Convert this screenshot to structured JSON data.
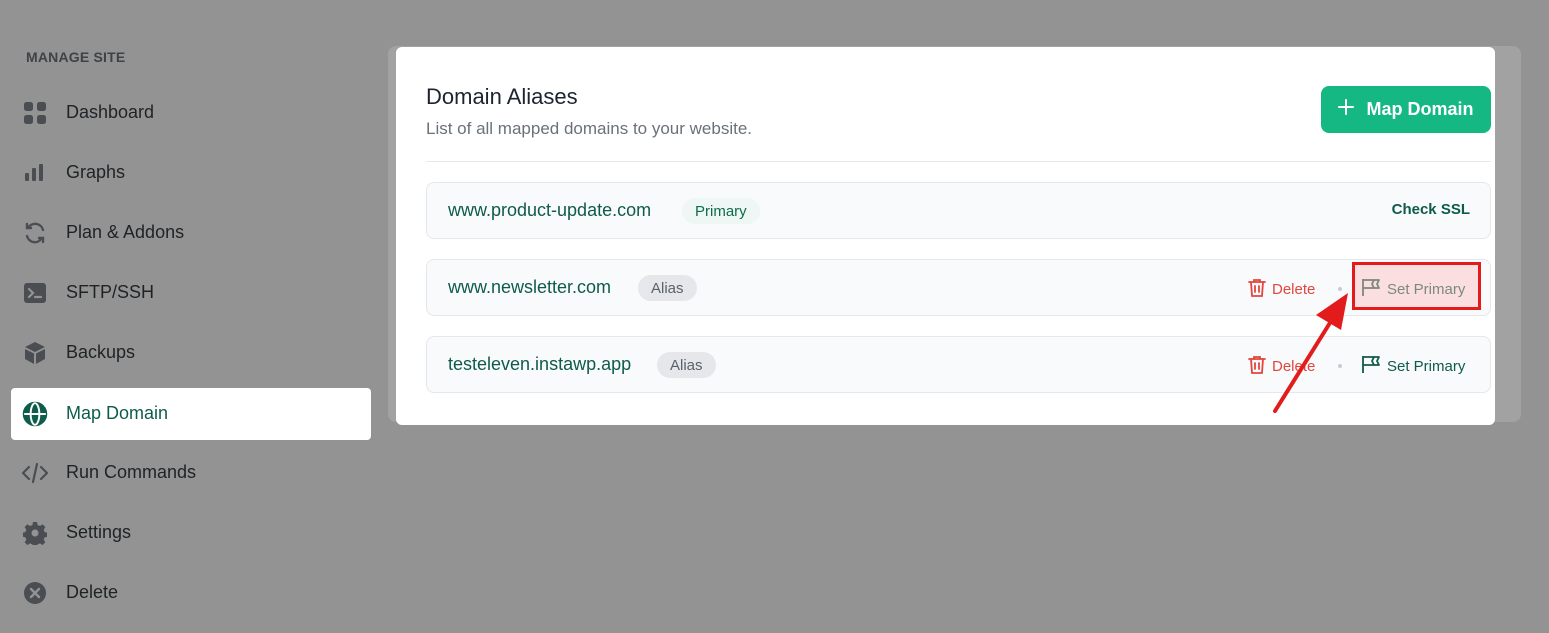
{
  "sidebar": {
    "heading": "MANAGE SITE",
    "items": [
      {
        "label": "Dashboard",
        "icon": "grid-icon"
      },
      {
        "label": "Graphs",
        "icon": "bar-chart-icon"
      },
      {
        "label": "Plan & Addons",
        "icon": "refresh-icon"
      },
      {
        "label": "SFTP/SSH",
        "icon": "terminal-icon"
      },
      {
        "label": "Backups",
        "icon": "cube-icon"
      },
      {
        "label": "Map Domain",
        "icon": "globe-icon",
        "active": true
      },
      {
        "label": "Run Commands",
        "icon": "code-icon"
      },
      {
        "label": "Settings",
        "icon": "gear-icon"
      },
      {
        "label": "Delete",
        "icon": "x-circle-icon"
      }
    ]
  },
  "panel": {
    "title": "Domain Aliases",
    "subtitle": "List of all mapped domains to your website.",
    "map_button_label": "Map Domain"
  },
  "domains": [
    {
      "name": "www.product-update.com",
      "badge": "Primary",
      "actions": [
        "Check SSL"
      ]
    },
    {
      "name": "www.newsletter.com",
      "badge": "Alias",
      "actions": [
        "Delete",
        "Set Primary"
      ]
    },
    {
      "name": "testeleven.instawp.app",
      "badge": "Alias",
      "actions": [
        "Delete",
        "Set Primary"
      ]
    }
  ],
  "colors": {
    "accent": "#15b882",
    "brand_text": "#0f5b4a",
    "danger": "#e2463d",
    "annotation": "#e21c1c"
  }
}
